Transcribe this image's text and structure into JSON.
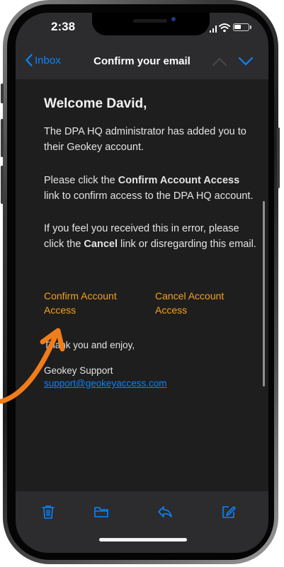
{
  "status_bar": {
    "time": "2:38"
  },
  "nav": {
    "back_label": "Inbox",
    "title": "Confirm your email"
  },
  "email": {
    "greeting": "Welcome David,",
    "p1": "The DPA HQ administrator has added you to their Geokey account.",
    "p2_before": "Please click the ",
    "p2_bold": "Confirm Account Access",
    "p2_after": " link to confirm access to the DPA HQ account.",
    "p3_before": "If you feel you received this in error, please click the ",
    "p3_bold": "Cancel",
    "p3_after": " link or disregarding this email.",
    "confirm_link": "Confirm Account Access",
    "cancel_link": "Cancel Account Access",
    "thanks": "Thank you and enjoy,",
    "support_name": "Geokey Support",
    "support_email": "support@geokeyaccess.com"
  },
  "colors": {
    "accent_blue": "#0a84ff",
    "link_orange": "#f5a01a",
    "arrow_orange": "#f07d1a",
    "background": "#1e1e1e",
    "bar": "#2c2c2e"
  },
  "icons": {
    "back": "chevron-left-icon",
    "prev": "chevron-up-icon",
    "next": "chevron-down-icon",
    "trash": "trash-icon",
    "folder": "folder-icon",
    "reply": "reply-icon",
    "compose": "compose-icon"
  }
}
